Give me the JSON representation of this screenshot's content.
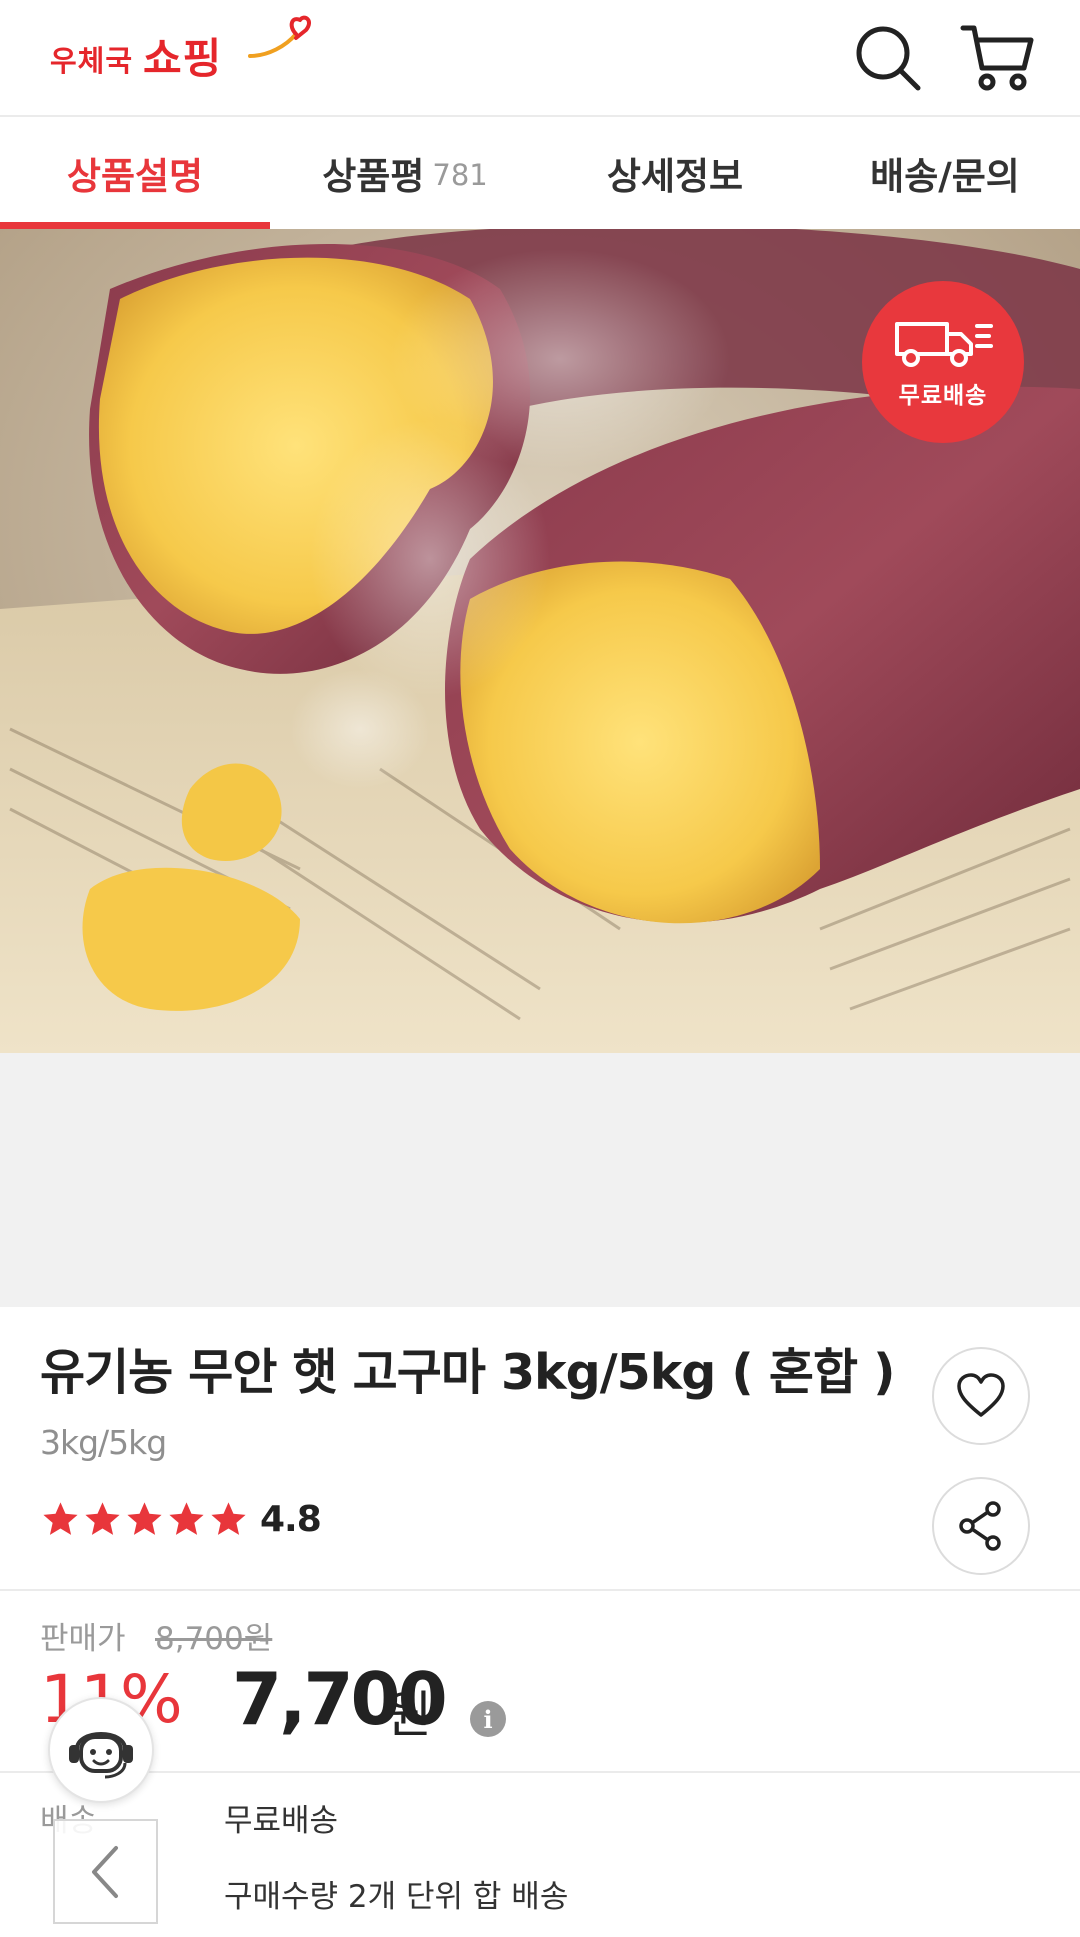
{
  "header": {
    "logo_small": "우체국",
    "logo_big": "쇼핑",
    "search_icon": "search-icon",
    "cart_icon": "cart-icon",
    "brand_color": "#e5262b"
  },
  "tabs": [
    {
      "label": "상품설명",
      "count": "",
      "active": true
    },
    {
      "label": "상품평",
      "count": "781",
      "active": false
    },
    {
      "label": "상세정보",
      "count": "",
      "active": false
    },
    {
      "label": "배송/문의",
      "count": "",
      "active": false
    }
  ],
  "hero": {
    "badge_text": "무료배송",
    "badge_icon": "delivery-truck-icon",
    "badge_color": "#e8383d"
  },
  "product": {
    "title": "유기농 무안 햇 고구마 3kg/5kg ( 혼합 )",
    "subtitle": "3kg/5kg",
    "rating": "4.8",
    "stars": 5,
    "wishlist_icon": "heart-icon",
    "share_icon": "share-icon"
  },
  "price": {
    "label": "판매가",
    "original": "8,700원",
    "discount": "11%",
    "final": "7,700",
    "unit": "원",
    "info_icon": "i",
    "accent": "#e8363b"
  },
  "delivery": {
    "label": "배송",
    "value": "무료배송",
    "note": "구매수량 2개 단위 합 배송"
  },
  "floating": {
    "chatbot_icon": "chatbot-headset-icon",
    "back_icon": "chevron-left-icon"
  }
}
